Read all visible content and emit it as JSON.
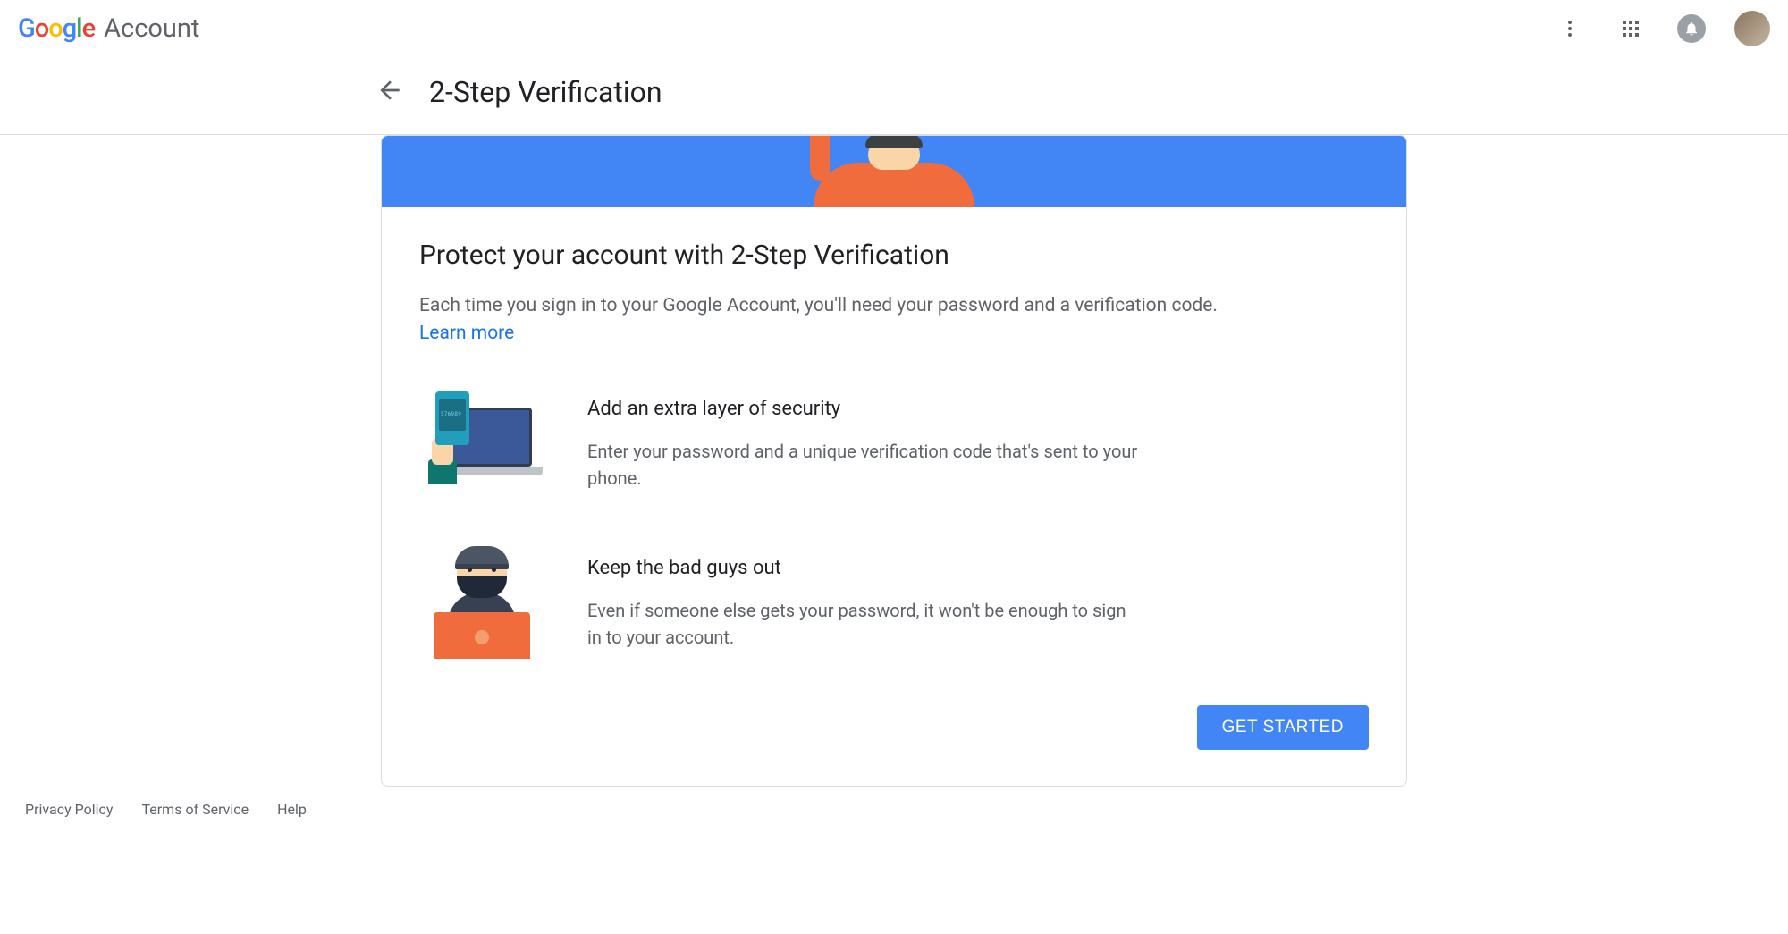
{
  "header": {
    "product": "Account"
  },
  "page": {
    "title": "2-Step Verification"
  },
  "card": {
    "title": "Protect your account with 2-Step Verification",
    "description": "Each time you sign in to your Google Account, you'll need your password and a verification code.",
    "learn_more": "Learn more",
    "features": [
      {
        "title": "Add an extra layer of security",
        "description": "Enter your password and a unique verification code that's sent to your phone."
      },
      {
        "title": "Keep the bad guys out",
        "description": "Even if someone else gets your password, it won't be enough to sign in to your account."
      }
    ],
    "cta": "GET STARTED"
  },
  "footer": {
    "links": [
      "Privacy Policy",
      "Terms of Service",
      "Help"
    ]
  }
}
